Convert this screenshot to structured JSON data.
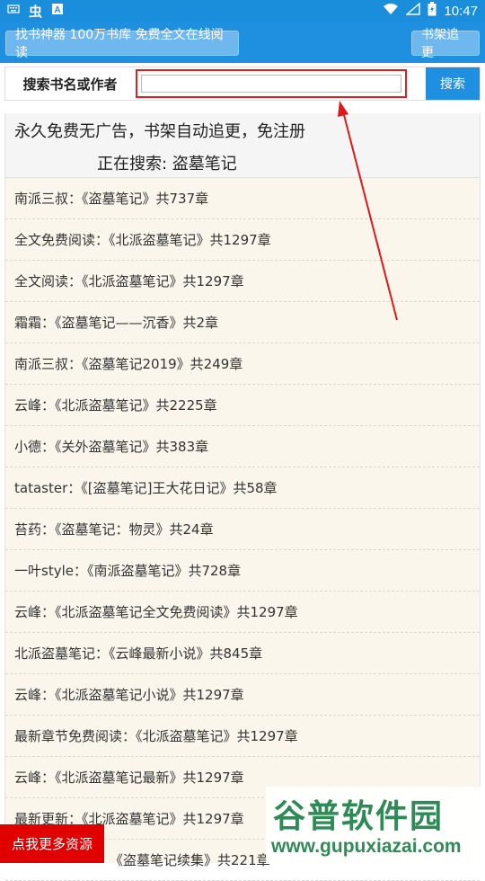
{
  "status_bar": {
    "time": "10:47",
    "icons": [
      "keyboard-icon",
      "app-icon",
      "a-icon",
      "wifi-icon",
      "signal-icon",
      "battery-icon"
    ]
  },
  "header": {
    "left_button": "找书神器 100万书库 免费全文在线阅读",
    "right_button": "书架追更"
  },
  "search": {
    "label": "搜索书名或作者",
    "input_value": "",
    "button": "搜索"
  },
  "notice": {
    "line1": "永久免费无广告，书架自动追更，免注册",
    "line2": "正在搜索: 盗墓笔记"
  },
  "results": [
    "南派三叔：《盗墓笔记》共737章",
    "全文免费阅读：《北派盗墓笔记》共1297章",
    "全文阅读：《北派盗墓笔记》共1297章",
    "霜霜：《盗墓笔记——沉香》共2章",
    "南派三叔：《盗墓笔记2019》共249章",
    "云峰：《北派盗墓笔记》共2225章",
    "小德：《关外盗墓笔记》共383章",
    "tataster：《[盗墓笔记]王大花日记》共58章",
    "苔药：《盗墓笔记：物灵》共24章",
    "一叶style：《南派盗墓笔记》共728章",
    "云峰：《北派盗墓笔记全文免费阅读》共1297章",
    "北派盗墓笔记：《云峰最新小说》共845章",
    "云峰：《北派盗墓笔记小说》共1297章",
    "最新章节免费阅读：《北派盗墓笔记》共1297章",
    "云峰：《北派盗墓笔记最新》共1297章",
    "最新更新：《北派盗墓笔记》共1297章",
    "《盗墓笔记续集》共221章"
  ],
  "bottom_button": "点我更多资源",
  "watermark": {
    "line1": "谷普软件园",
    "line2": "www.gupuxiazai.com"
  }
}
